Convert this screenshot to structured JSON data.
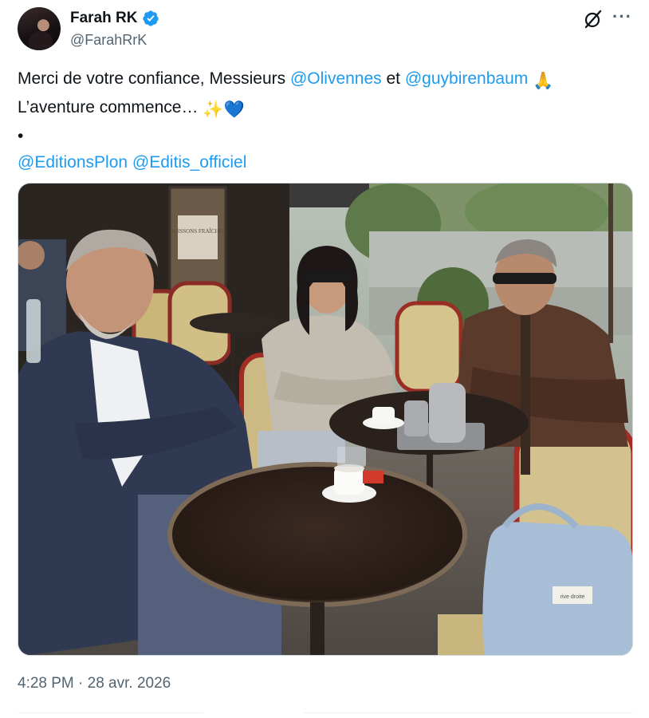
{
  "author": {
    "display_name": "Farah RK",
    "handle": "@FarahRrK",
    "verified_icon": "verified-badge-icon",
    "badge_color": "#1d9bf0"
  },
  "header_icons": [
    "grok-icon",
    "more-options-icon"
  ],
  "tweet": {
    "line1_text": "Merci de votre confiance, Messieurs ",
    "mention1": "@Olivennes",
    "line1_mid": " et ",
    "mention2": "@guybirenbaum",
    "line1_emoji": "🙏",
    "line2_text": "L’aventure commence… ",
    "line2_emoji1": "✨",
    "line2_emoji2": "💙",
    "bullet": "•",
    "mention3": "@EditionsPlon",
    "mention4": "@Editis_officiel"
  },
  "photo": {
    "alt_description_icon": "tweet-photo",
    "awning_sign_text": "BOISSONS FRAÎCHES",
    "bag_label": "rive droite"
  },
  "meta": {
    "timestamp": "4:28 PM · 28 avr. 2026"
  },
  "colors": {
    "link": "#1d9bf0",
    "secondary_text": "#536471",
    "primary_text": "#0f1419"
  }
}
